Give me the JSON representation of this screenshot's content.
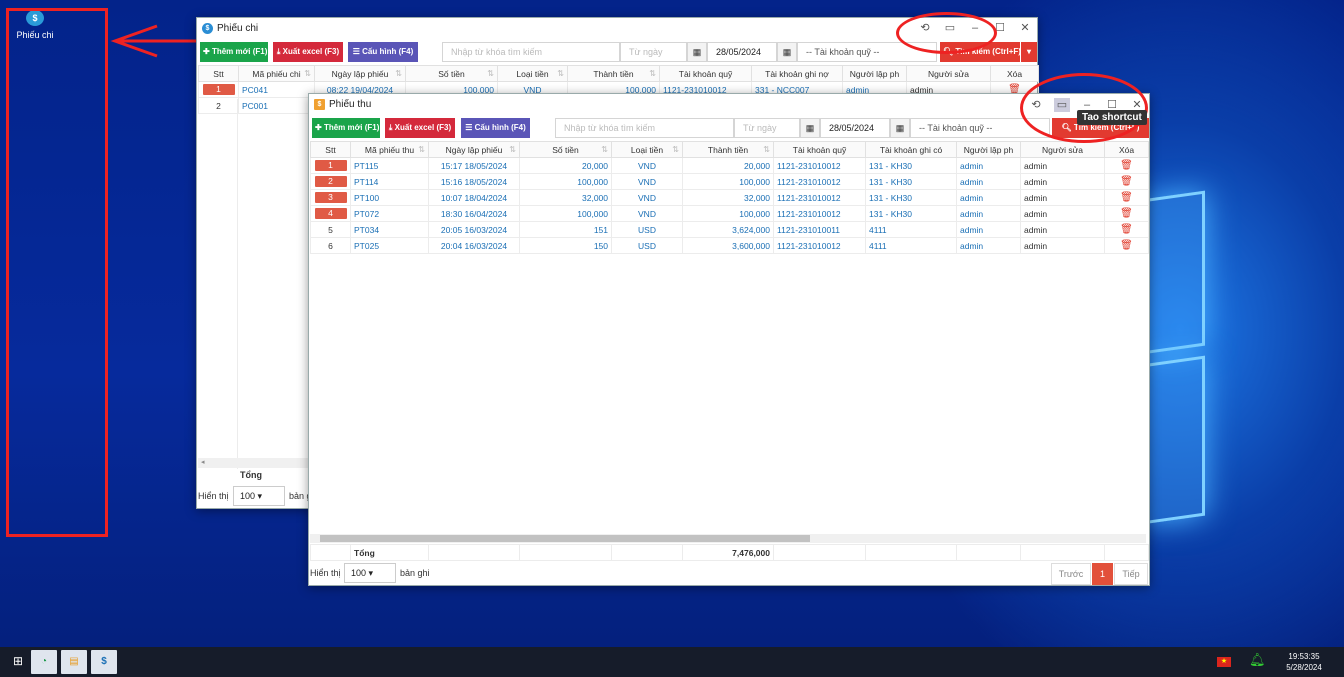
{
  "desktop": {
    "icon_label": "Phiếu chi",
    "icon_glyph": "$"
  },
  "win_chi": {
    "title": "Phiếu chi",
    "btn_new": "Thêm mới (F1)",
    "btn_excel": "Xuất excel (F3)",
    "btn_config": "Cấu hình (F4)",
    "search_placeholder": "Nhập từ khóa tìm kiếm",
    "from_placeholder": "Từ ngày",
    "to_date": "28/05/2024",
    "fund_select": "-- Tài khoản quỹ --",
    "btn_search": "Tìm kiếm (Ctrl+F)",
    "headers": [
      "Stt",
      "Mã phiếu chi",
      "Ngày lập phiếu",
      "Số tiền",
      "Loại tiền",
      "Thành tiền",
      "Tài khoản quỹ",
      "Tài khoản ghi nợ",
      "Người lập ph",
      "Người sửa",
      "Xóa"
    ],
    "rows": [
      [
        "1",
        "PC041",
        "08:22 19/04/2024",
        "100,000",
        "VND",
        "100,000",
        "1121-231010012",
        "331 - NCC007",
        "admin",
        "admin"
      ],
      [
        "2",
        "PC001",
        "",
        "",
        "",
        "",
        "",
        "",
        "",
        ""
      ]
    ],
    "total_label": "Tổng",
    "show_label": "Hiển thị",
    "page_size": "100",
    "records_label": "bản g"
  },
  "win_thu": {
    "title": "Phiếu thu",
    "btn_new": "Thêm mới (F1)",
    "btn_excel": "Xuất excel (F3)",
    "btn_config": "Cấu hình (F4)",
    "search_placeholder": "Nhập từ khóa tìm kiếm",
    "from_placeholder": "Từ ngày",
    "to_date": "28/05/2024",
    "fund_select": "-- Tài khoản quỹ --",
    "btn_search": "Tìm kiếm (Ctrl+F)",
    "headers": [
      "Stt",
      "Mã phiếu thu",
      "Ngày lập phiếu",
      "Số tiền",
      "Loại tiền",
      "Thành tiền",
      "Tài khoản quỹ",
      "Tài khoản ghi có",
      "Người lập ph",
      "Người sửa",
      "Xóa"
    ],
    "rows": [
      [
        "1",
        "PT115",
        "15:17 18/05/2024",
        "20,000",
        "VND",
        "20,000",
        "1121-231010012",
        "131 - KH30",
        "admin",
        "admin"
      ],
      [
        "2",
        "PT114",
        "15:16 18/05/2024",
        "100,000",
        "VND",
        "100,000",
        "1121-231010012",
        "131 - KH30",
        "admin",
        "admin"
      ],
      [
        "3",
        "PT100",
        "10:07 18/04/2024",
        "32,000",
        "VND",
        "32,000",
        "1121-231010012",
        "131 - KH30",
        "admin",
        "admin"
      ],
      [
        "4",
        "PT072",
        "18:30 16/04/2024",
        "100,000",
        "VND",
        "100,000",
        "1121-231010012",
        "131 - KH30",
        "admin",
        "admin"
      ],
      [
        "5",
        "PT034",
        "20:05 16/03/2024",
        "151",
        "USD",
        "3,624,000",
        "1121-231010011",
        "4111",
        "admin",
        "admin"
      ],
      [
        "6",
        "PT025",
        "20:04 16/03/2024",
        "150",
        "USD",
        "3,600,000",
        "1121-231010012",
        "4111",
        "admin",
        "admin"
      ]
    ],
    "total_label": "Tổng",
    "total_value": "7,476,000",
    "show_label": "Hiển thị",
    "page_size": "100",
    "records_label": "bản ghi",
    "prev": "Trước",
    "page": "1",
    "next": "Tiếp"
  },
  "tooltip": "Tao shortcut",
  "taskbar": {
    "time": "19:53:35",
    "date": "5/28/2024"
  },
  "colors": {
    "annotation": "#e22222",
    "badge": "#e05a45",
    "primary_link": "#1a6fb5"
  }
}
